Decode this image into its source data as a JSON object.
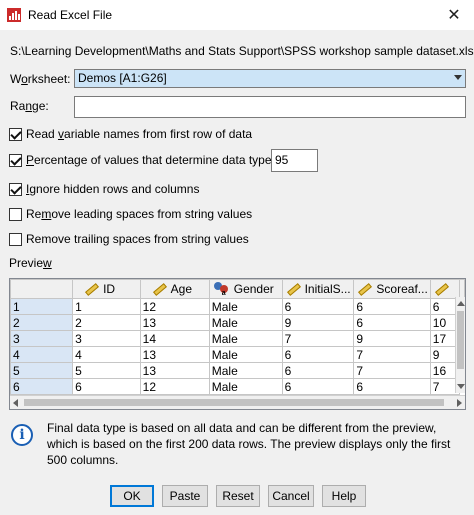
{
  "window": {
    "title": "Read Excel File",
    "close_glyph": "✕"
  },
  "file_path": "S:\\Learning Development\\Maths and Stats Support\\SPSS workshop sample dataset.xlsx",
  "worksheet": {
    "label_pre": "W",
    "label_u": "o",
    "label_post": "rksheet:",
    "value": "Demos [A1:G26]"
  },
  "range": {
    "label_pre": "Ra",
    "label_u": "n",
    "label_post": "ge:",
    "value": ""
  },
  "options": {
    "read_names": {
      "checked": true,
      "pre": "Read ",
      "u": "v",
      "post": "ariable names from first row of data"
    },
    "percentage": {
      "checked": true,
      "pre": "",
      "u": "P",
      "post": "ercentage of values that determine data type:",
      "value": "95"
    },
    "ignore_hidden": {
      "checked": true,
      "pre": "",
      "u": "I",
      "post": "gnore hidden rows and columns"
    },
    "remove_leading": {
      "checked": false,
      "pre": "Re",
      "u": "m",
      "post": "ove leading spaces from string values"
    },
    "remove_trailing": {
      "checked": false,
      "pre": "Remove trailing spaces from string values",
      "u": "",
      "post": ""
    }
  },
  "preview": {
    "label_pre": "Previe",
    "label_u": "w",
    "label_post": "",
    "columns": [
      {
        "name": "ID",
        "icon": "ruler-icon"
      },
      {
        "name": "Age",
        "icon": "ruler-icon"
      },
      {
        "name": "Gender",
        "icon": "nominal-people-icon"
      },
      {
        "name": "InitialS...",
        "icon": "ruler-icon"
      },
      {
        "name": "Scoreaf...",
        "icon": "ruler-icon"
      },
      {
        "name": "",
        "icon": "ruler-icon"
      }
    ],
    "rows": [
      {
        "num": "1",
        "cells": [
          "1",
          "12",
          "Male",
          "6",
          "6",
          "6"
        ]
      },
      {
        "num": "2",
        "cells": [
          "2",
          "13",
          "Male",
          "9",
          "6",
          "10"
        ]
      },
      {
        "num": "3",
        "cells": [
          "3",
          "14",
          "Male",
          "7",
          "9",
          "17"
        ]
      },
      {
        "num": "4",
        "cells": [
          "4",
          "13",
          "Male",
          "6",
          "7",
          "9"
        ]
      },
      {
        "num": "5",
        "cells": [
          "5",
          "13",
          "Male",
          "6",
          "7",
          "16"
        ]
      },
      {
        "num": "6",
        "cells": [
          "6",
          "12",
          "Male",
          "6",
          "6",
          "7"
        ]
      }
    ]
  },
  "info": {
    "icon": "info-icon",
    "text": "Final data type is based on all data and can be different from the preview, which is based on the first 200 data rows. The preview displays only the first 500 columns."
  },
  "buttons": {
    "ok": "OK",
    "paste": "Paste",
    "reset": "Reset",
    "cancel": "Cancel",
    "help": "Help"
  }
}
